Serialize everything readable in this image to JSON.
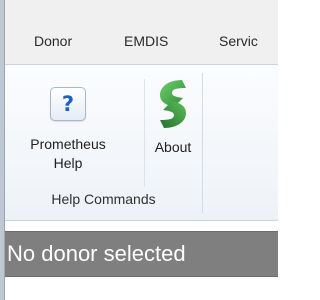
{
  "ribbon": {
    "tabs": [
      {
        "label": "Donor"
      },
      {
        "label": "EMDIS"
      },
      {
        "label": "Servic"
      }
    ],
    "groups": [
      {
        "label": "Help Commands",
        "buttons": [
          {
            "label_line1": "Prometheus",
            "label_line2": "Help",
            "icon": "help-question-icon",
            "icon_glyph": "?"
          },
          {
            "label": "About",
            "icon": "green-s-logo-icon"
          }
        ]
      }
    ]
  },
  "status": {
    "text": "No donor selected"
  },
  "colors": {
    "help_icon_blue": "#1e63c4",
    "logo_green_dark": "#2e8b3a",
    "logo_green_light": "#5cc15a",
    "status_background": "#7f7f7f"
  }
}
